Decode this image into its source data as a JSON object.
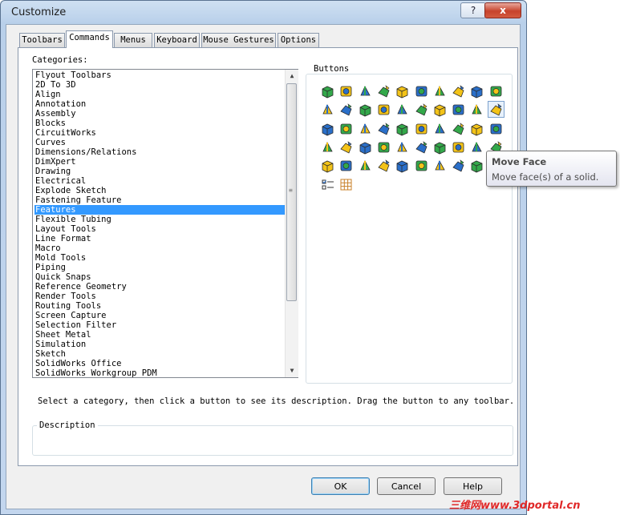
{
  "window": {
    "title": "Customize",
    "help_glyph": "?",
    "close_glyph": "x"
  },
  "tabs": [
    {
      "label": "Toolbars",
      "active": false
    },
    {
      "label": "Commands",
      "active": true
    },
    {
      "label": "Menus",
      "active": false
    },
    {
      "label": "Keyboard",
      "active": false
    },
    {
      "label": "Mouse Gestures",
      "active": false
    },
    {
      "label": "Options",
      "active": false
    }
  ],
  "categories": {
    "label": "Categories:",
    "selected": "Features",
    "items": [
      "Flyout Toolbars",
      "2D To 3D",
      "Align",
      "Annotation",
      "Assembly",
      "Blocks",
      "CircuitWorks",
      "Curves",
      "Dimensions/Relations",
      "DimXpert",
      "Drawing",
      "Electrical",
      "Explode Sketch",
      "Fastening Feature",
      "Features",
      "Flexible Tubing",
      "Layout Tools",
      "Line Format",
      "Macro",
      "Mold Tools",
      "Piping",
      "Quick Snaps",
      "Reference Geometry",
      "Render Tools",
      "Routing Tools",
      "Screen Capture",
      "Selection Filter",
      "Sheet Metal",
      "Simulation",
      "Sketch",
      "SolidWorks Office",
      "SolidWorks Workgroup PDM"
    ]
  },
  "scrollbar": {
    "up_glyph": "▲",
    "down_glyph": "▼",
    "grip_glyph": "≡"
  },
  "buttons": {
    "label": "Buttons",
    "icons": [
      "extruded-boss-icon",
      "revolved-boss-icon",
      "swept-boss-icon",
      "lofted-boss-icon",
      "boundary-boss-icon",
      "extruded-cut-icon",
      "revolved-cut-icon",
      "swept-cut-icon",
      "lofted-cut-icon",
      "boundary-cut-icon",
      "fillet-icon",
      "chamfer-icon",
      "rib-icon",
      "shell-icon",
      "draft-icon",
      "dome-icon",
      "wrap-icon",
      "hole-icon",
      "mirror-icon",
      "move-face-icon",
      "linear-pattern-icon",
      "circular-pattern-icon",
      "curve-pattern-icon",
      "sketch-pattern-icon",
      "table-pattern-icon",
      "fill-pattern-icon",
      "split-icon",
      "combine-icon",
      "intersect-icon",
      "scale-icon",
      "thicken-icon",
      "move-copy-icon",
      "deform-icon",
      "indent-icon",
      "flex-icon",
      "freeform-icon",
      "cavity-icon",
      "delete-face-icon",
      "replace-face-icon",
      "delete-body-icon",
      "offset-surface-icon",
      "ruled-surface-icon",
      "knit-icon",
      "fill-surface-icon",
      "trim-surface-icon",
      "extend-surface-icon",
      "untrim-icon",
      "radiate-surface-icon",
      "planar-surface-icon",
      "thread-icon",
      "hole-series-icon",
      "grid-icon"
    ],
    "colors": {
      "green": "#33a84a",
      "yellow": "#f3c318",
      "blue": "#2a6fc9"
    }
  },
  "tooltip": {
    "title": "Move Face",
    "body": "Move face(s) of a solid."
  },
  "hint": "Select a category, then click a button to see its description. Drag the button to any toolbar.",
  "description": {
    "label": "Description",
    "text": ""
  },
  "dialog_buttons": {
    "ok": "OK",
    "cancel": "Cancel",
    "help": "Help"
  },
  "watermark": "三维网www.3dportal.cn"
}
